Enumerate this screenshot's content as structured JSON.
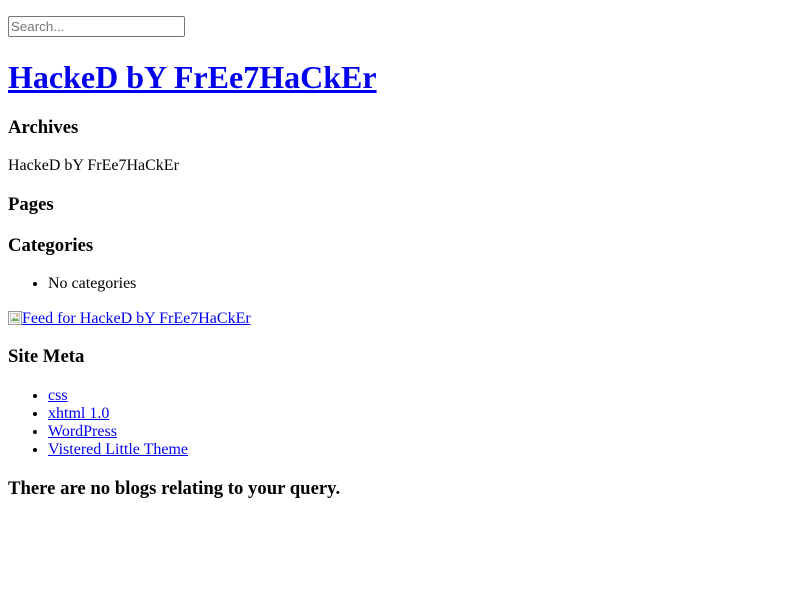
{
  "search": {
    "placeholder": "Search..."
  },
  "site_title": "HackeD bY FrEe7HaCkEr",
  "archives": {
    "heading": "Archives",
    "entry": "HackeD bY FrEe7HaCkEr"
  },
  "pages": {
    "heading": "Pages"
  },
  "categories": {
    "heading": "Categories",
    "items": [
      "No categories"
    ]
  },
  "feed": {
    "alt_text": "Feed for HackeD bY FrEe7HaCkEr",
    "icon": "broken-image-icon"
  },
  "site_meta": {
    "heading": "Site Meta",
    "links": [
      "css",
      "xhtml 1.0",
      "WordPress",
      "Vistered Little Theme"
    ]
  },
  "no_results": "There are no blogs relating to your query.",
  "colors": {
    "link": "#0000ee",
    "text": "#000000",
    "background": "#ffffff"
  }
}
